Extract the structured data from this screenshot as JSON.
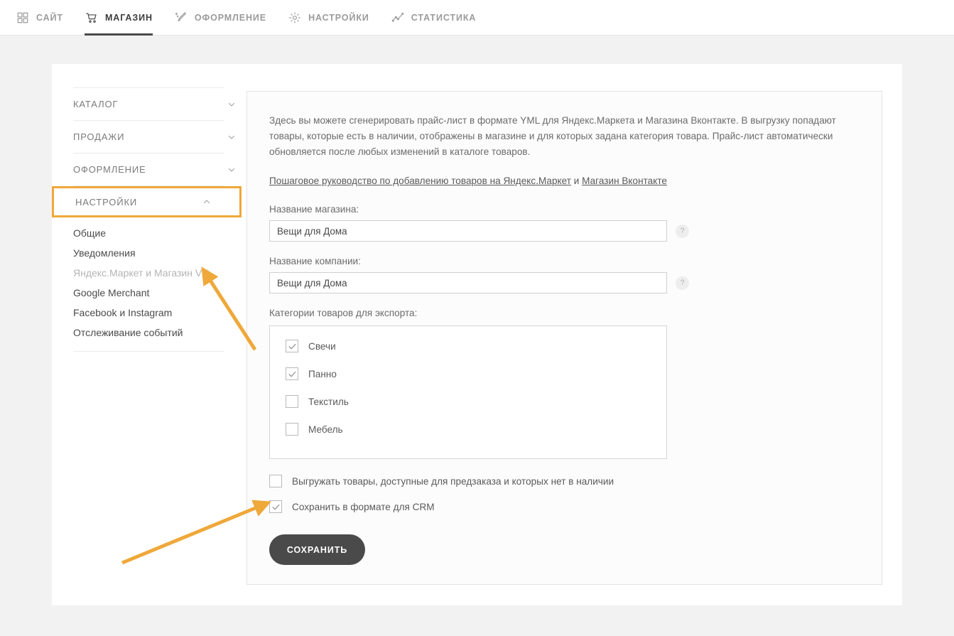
{
  "topnav": {
    "items": [
      {
        "label": "САЙТ",
        "icon": "grid-icon",
        "active": false
      },
      {
        "label": "МАГАЗИН",
        "icon": "cart-icon",
        "active": true
      },
      {
        "label": "ОФОРМЛЕНИЕ",
        "icon": "magic-wand-icon",
        "active": false
      },
      {
        "label": "НАСТРОЙКИ",
        "icon": "gear-icon",
        "active": false
      },
      {
        "label": "СТАТИСТИКА",
        "icon": "line-chart-icon",
        "active": false
      }
    ]
  },
  "sidebar": {
    "groups": [
      {
        "label": "КАТАЛОГ",
        "expanded": false,
        "chevron": "chevron-down-icon"
      },
      {
        "label": "ПРОДАЖИ",
        "expanded": false,
        "chevron": "chevron-down-icon"
      },
      {
        "label": "ОФОРМЛЕНИЕ",
        "expanded": false,
        "chevron": "chevron-down-icon"
      },
      {
        "label": "НАСТРОЙКИ",
        "expanded": true,
        "chevron": "chevron-up-icon",
        "highlighted": true
      }
    ],
    "subitems": [
      {
        "label": "Общие",
        "selected": false
      },
      {
        "label": "Уведомления",
        "selected": false
      },
      {
        "label": "Яндекс.Маркет и Магазин VK",
        "selected": true
      },
      {
        "label": "Google Merchant",
        "selected": false
      },
      {
        "label": "Facebook и Instagram",
        "selected": false
      },
      {
        "label": "Отслеживание событий",
        "selected": false
      }
    ]
  },
  "panel": {
    "intro": "Здесь вы можете сгенерировать прайс-лист в формате YML для Яндекс.Маркета и Магазина Вконтакте. В выгрузку попадают товары, которые есть в наличии, отображены в магазине и для которых задана категория товара. Прайс-лист автоматически обновляется после любых изменений в каталоге товаров.",
    "link_primary": "Пошаговое руководство по добавлению товаров на Яндекс.Маркет",
    "link_conjunction": " и ",
    "link_secondary": "Магазин Вконтакте",
    "shop_name_label": "Название магазина:",
    "shop_name_value": "Вещи для Дома",
    "company_name_label": "Название компании:",
    "company_name_value": "Вещи для Дома",
    "help_glyph": "?",
    "categories_label": "Категории товаров для экспорта:",
    "categories": [
      {
        "label": "Свечи",
        "checked": true
      },
      {
        "label": "Панно",
        "checked": true
      },
      {
        "label": "Текстиль",
        "checked": false
      },
      {
        "label": "Мебель",
        "checked": false
      }
    ],
    "option_preorder": {
      "label": "Выгружать товары, доступные для предзаказа и которых нет в наличии",
      "checked": false
    },
    "option_crm": {
      "label": "Сохранить в формате для CRM",
      "checked": true
    },
    "save_label": "СОХРАНИТЬ"
  },
  "colors": {
    "page_background": "#f2f2f2",
    "card_background": "#ffffff",
    "panel_background": "#fcfcfc",
    "accent_highlight": "#efa83a",
    "button_dark": "#4a4a4a",
    "text_muted": "#9b9b9b"
  }
}
